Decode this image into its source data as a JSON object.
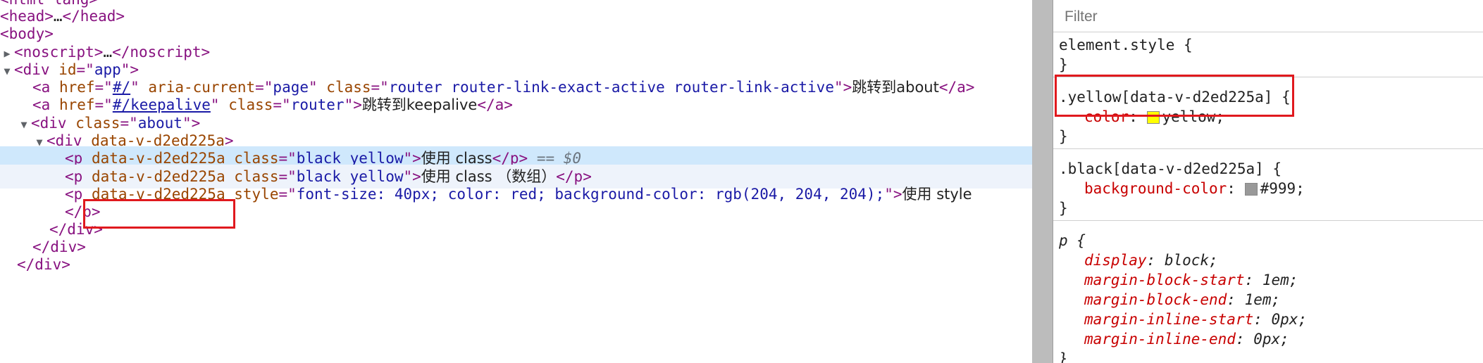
{
  "elements": {
    "line0_head": "<html lang>",
    "line1": {
      "open": "<head>",
      "ellipsis": "…",
      "close": "</head>"
    },
    "line2": {
      "tag": "<body>"
    },
    "line3": {
      "open": "<noscript>",
      "ellipsis": "…",
      "close": "</noscript>"
    },
    "line4": {
      "open": "<div ",
      "attr": "id",
      "eq": "=\"",
      "val": "app",
      "end": "\">"
    },
    "line5": {
      "open": "<a ",
      "a1": "href",
      "v1": "#/",
      "a2": "aria-current",
      "v2": "page",
      "a3": "class",
      "v3": "router router-link-exact-active router-link-active",
      "text": "跳转到about",
      "close": "</a>"
    },
    "line6": {
      "open": "<a ",
      "a1": "href",
      "v1": "#/keepalive",
      "a2": "class",
      "v2": "router",
      "text": "跳转到keepalive",
      "close": "</a>"
    },
    "line7": {
      "open": "<div ",
      "attr": "class",
      "val": "about",
      "end": "\">"
    },
    "line8": {
      "open": "<div ",
      "attr": "data-v-d2ed225a",
      "end": ">"
    },
    "line9": {
      "open": "<p ",
      "a1": "data-v-d2ed225a",
      "a2": "class",
      "v2": "black yellow",
      "text": "使用 class",
      "close": "</p>",
      "dollar": "== $0"
    },
    "line10": {
      "open": "<p ",
      "a1": "data-v-d2ed225a",
      "a2": "class",
      "v2": "black yellow",
      "text": "使用 class （数组）",
      "close": "</p>"
    },
    "line11": {
      "open": "<p ",
      "a1": "data-v-d2ed225a",
      "a2": "style",
      "v2": "font-size: 40px; color: red; background-color: rgb(204, 204, 204);",
      "text": "使用 style"
    },
    "line12": "</p>",
    "line13": "</div>",
    "line14": "</div>",
    "line15": "</div>"
  },
  "styles": {
    "filter_placeholder": "Filter",
    "element_style": {
      "selector": "element.style {",
      "close": "}"
    },
    "yellow_rule": {
      "selector": ".yellow[data-v-d2ed225a]",
      "brace": " {",
      "prop": "color",
      "value": "yellow;",
      "swatch": "#ffff00",
      "close": "}"
    },
    "black_rule": {
      "selector": ".black[data-v-d2ed225a] {",
      "prop": "background-color",
      "value": "#999;",
      "swatch": "#999999",
      "close": "}"
    },
    "p_rule": {
      "selector": "p {",
      "props": [
        {
          "name": "display",
          "value": "block;"
        },
        {
          "name": "margin-block-start",
          "value": "1em;"
        },
        {
          "name": "margin-block-end",
          "value": "1em;"
        },
        {
          "name": "margin-inline-start",
          "value": "0px;"
        },
        {
          "name": "margin-inline-end",
          "value": "0px;"
        }
      ],
      "close": "}"
    }
  },
  "colors": {
    "highlight_box": "#e0191e",
    "selected_row": "#cfe8fc"
  }
}
